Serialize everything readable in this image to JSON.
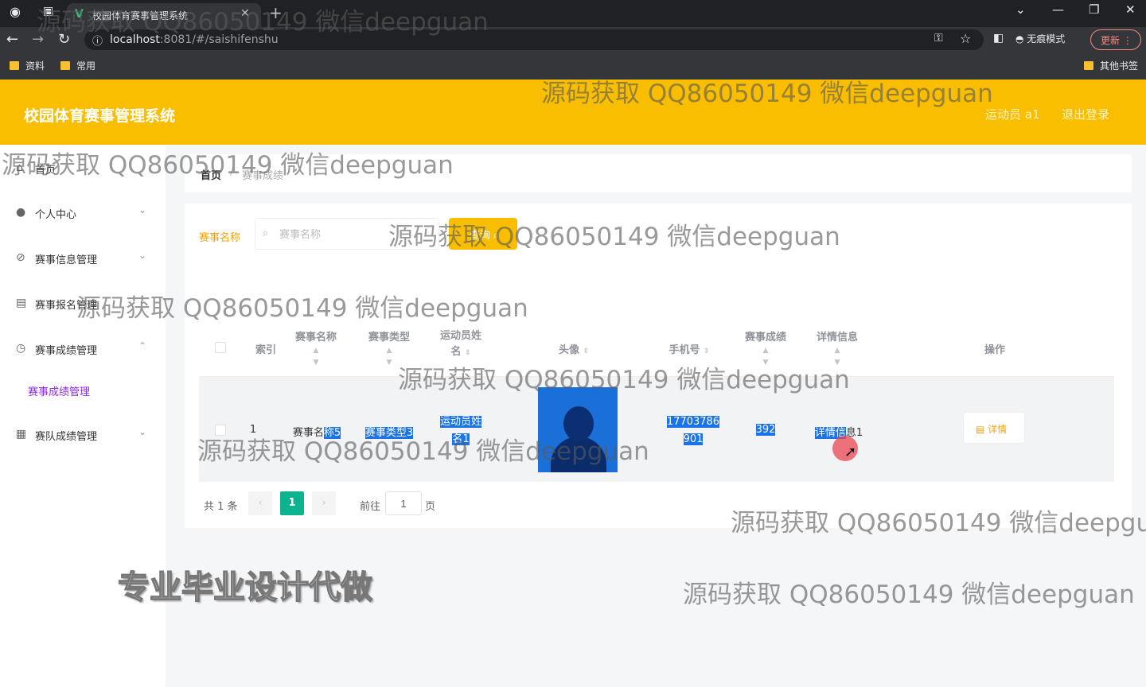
{
  "browser": {
    "tab_title": "校园体育赛事管理系统",
    "url_host": "localhost",
    "url_rest": ":8081/#/saishifenshu",
    "incognito_label": "无痕模式",
    "update_label": "更新",
    "bookmarks": [
      "资料",
      "常用"
    ],
    "other_bookmarks": "其他书签"
  },
  "header": {
    "title": "校园体育赛事管理系统",
    "user_label": "运动员 a1",
    "logout_label": "退出登录"
  },
  "sidebar": {
    "items": [
      {
        "label": "首页",
        "icon": "home-icon"
      },
      {
        "label": "个人中心",
        "icon": "user-icon"
      },
      {
        "label": "赛事信息管理",
        "icon": "compass-icon"
      },
      {
        "label": "赛事报名管理",
        "icon": "clipboard-icon"
      },
      {
        "label": "赛事成绩管理",
        "icon": "clock-icon"
      },
      {
        "label": "赛事成绩管理",
        "icon": "submenu"
      },
      {
        "label": "赛队成绩管理",
        "icon": "grid-icon"
      }
    ]
  },
  "breadcrumb": {
    "home": "首页",
    "current": "赛事成绩"
  },
  "search": {
    "label": "赛事名称",
    "placeholder": "赛事名称",
    "button_label": "查询"
  },
  "table": {
    "headers": {
      "index": "索引",
      "name": "赛事名称",
      "type": "赛事类型",
      "athlete_a": "运动员姓",
      "athlete_b": "名",
      "avatar": "头像",
      "phone": "手机号",
      "score": "赛事成绩",
      "detail": "详情信息",
      "action": "操作"
    },
    "rows": [
      {
        "index": "1",
        "name_a": "赛事名",
        "name_b": "称5",
        "type": "赛事类型3",
        "athlete_a": "运动员姓",
        "athlete_b": "名1",
        "phone_a": "17703786",
        "phone_b": "901",
        "score": "392",
        "detail_a": "详情信",
        "detail_b": "息1",
        "action_label": "详情"
      }
    ]
  },
  "pagination": {
    "total": "共 1 条",
    "current_page": "1",
    "goto_label": "前往",
    "goto_value": "1",
    "page_unit": "页"
  },
  "watermarks": {
    "text": "源码获取 QQ86050149 微信deepguan",
    "promo": "专业毕业设计代做"
  },
  "colors": {
    "brand": "#fabe00",
    "accent_green": "#0bb38e",
    "selection": "#1a73e8"
  }
}
